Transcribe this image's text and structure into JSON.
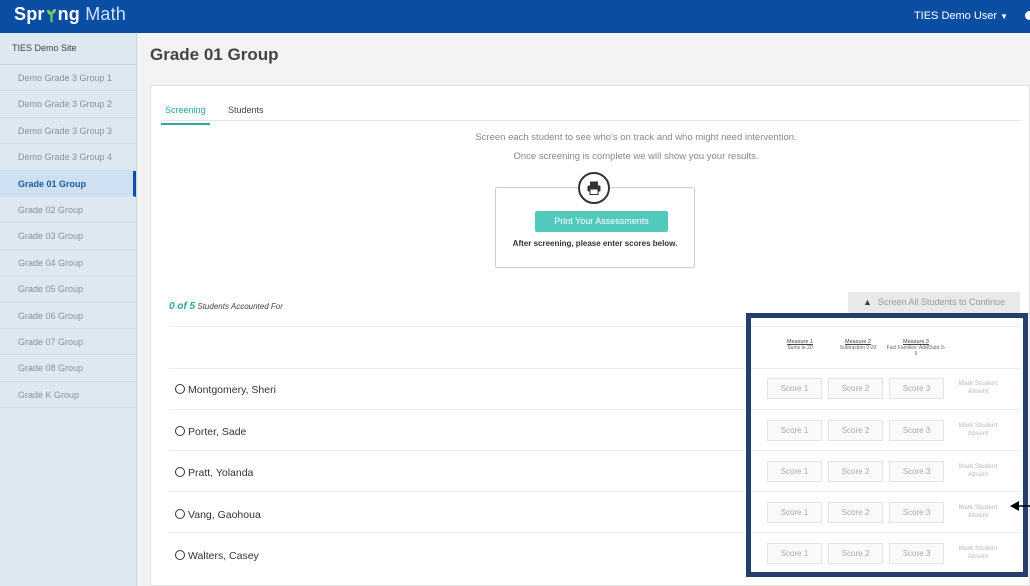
{
  "app": {
    "logo_part1": "Spr",
    "logo_part2": "ng",
    "logo_part3": "Math",
    "user": "TIES Demo User"
  },
  "sidebar": {
    "site": "TIES Demo Site",
    "items": [
      {
        "label": "Demo Grade 3 Group 1"
      },
      {
        "label": "Demo Grade 3 Group 2"
      },
      {
        "label": "Demo Grade 3 Group 3"
      },
      {
        "label": "Demo Grade 3 Group 4"
      },
      {
        "label": "Grade 01 Group"
      },
      {
        "label": "Grade 02 Group"
      },
      {
        "label": "Grade 03 Group"
      },
      {
        "label": "Grade 04 Group"
      },
      {
        "label": "Grade 05 Group"
      },
      {
        "label": "Grade 06 Group"
      },
      {
        "label": "Grade 07 Group"
      },
      {
        "label": "Grade 08 Group"
      },
      {
        "label": "Grade K Group"
      }
    ],
    "active_index": 4
  },
  "main": {
    "title": "Grade 01 Group",
    "tabs": [
      {
        "label": "Screening"
      },
      {
        "label": "Students"
      }
    ],
    "intro_line1": "Screen each student to see who's on track and who might need intervention.",
    "intro_line2": "Once screening is complete we will show you your results.",
    "print_button": "Print Your Assessments",
    "print_note": "After screening, please enter scores below.",
    "accounted_count": "0 of 5",
    "accounted_label": "Students Accounted For",
    "continue_button": "Screen All Students to Continue",
    "measures": [
      {
        "title": "Measure 1",
        "desc": "Sums to 20"
      },
      {
        "title": "Measure 2",
        "desc": "Subtraction 0-20"
      },
      {
        "title": "Measure 3",
        "desc": "Fact Families: Add/Subt 0-9"
      }
    ],
    "score_placeholders": [
      "Score 1",
      "Score 2",
      "Score 3"
    ],
    "absent_label": "Mark Student Absent",
    "students": [
      {
        "name": "Montgomery, Sheri"
      },
      {
        "name": "Porter, Sade"
      },
      {
        "name": "Pratt, Yolanda"
      },
      {
        "name": "Vang, Gaohoua"
      },
      {
        "name": "Walters, Casey"
      }
    ]
  },
  "colors": {
    "nav": "#0a4ea3",
    "accent": "#2aa7a0",
    "print_button": "#53c9bd",
    "highlight_border": "#253f6b"
  }
}
